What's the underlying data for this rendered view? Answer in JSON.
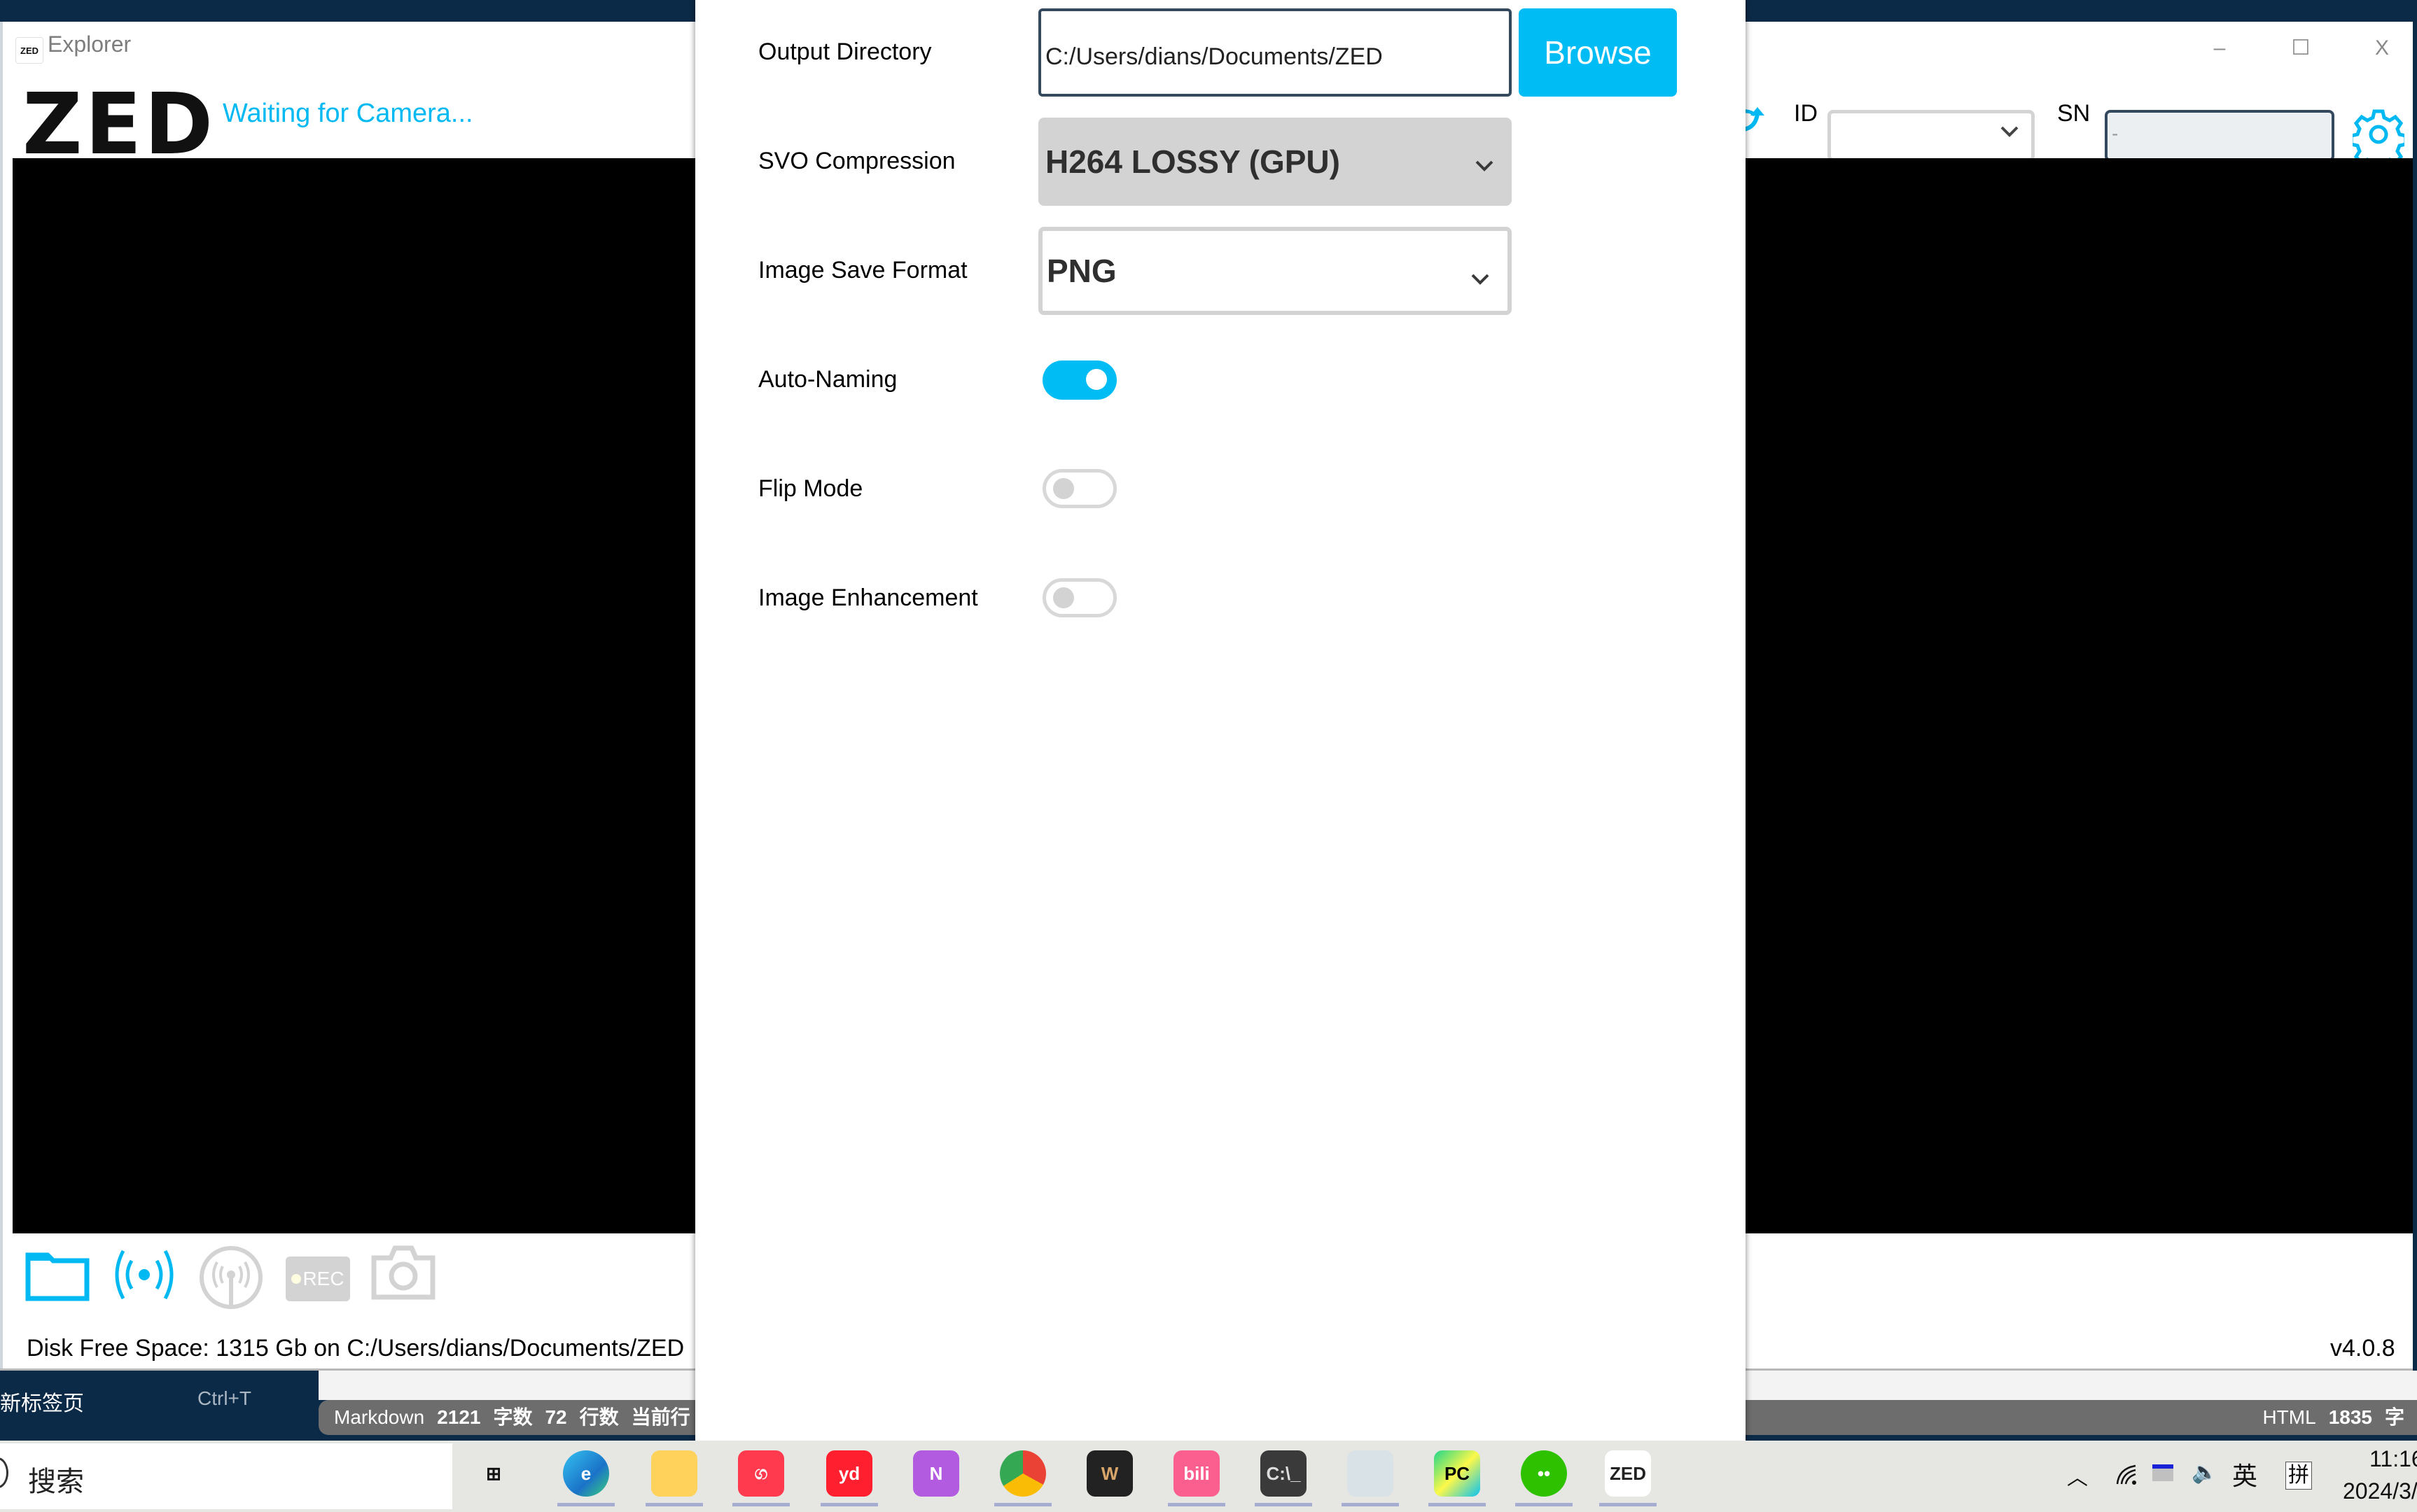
{
  "window": {
    "app_title": "Explorer",
    "app_logo_small": "ZED",
    "logo_text": "ZED",
    "status_text": "Waiting for Camera...",
    "controls": {
      "minimize": "–",
      "maximize": "☐",
      "close": "X"
    }
  },
  "header": {
    "refresh_icon": "refresh-icon",
    "id_label": "ID",
    "id_value": "",
    "sn_label": "SN",
    "sn_value": "-",
    "settings_icon": "gear-icon"
  },
  "toolbar": {
    "icons": [
      "folder-icon",
      "stream-icon",
      "antenna-icon",
      "rec-icon",
      "camera-icon"
    ],
    "rec_label": "REC"
  },
  "footer": {
    "disk_text": "Disk Free Space: 1315 Gb  on C:/Users/dians/Documents/ZED",
    "version": "v4.0.8"
  },
  "settings": {
    "output_directory": {
      "label": "Output Directory",
      "value": "C:/Users/dians/Documents/ZED",
      "browse_label": "Browse"
    },
    "svo_compression": {
      "label": "SVO Compression",
      "selected": "H264 LOSSY (GPU)"
    },
    "image_save_format": {
      "label": "Image Save Format",
      "selected": "PNG"
    },
    "auto_naming": {
      "label": "Auto-Naming",
      "enabled": true
    },
    "flip_mode": {
      "label": "Flip Mode",
      "enabled": false
    },
    "image_enhancement": {
      "label": "Image Enhancement",
      "enabled": false
    }
  },
  "background_app": {
    "tab_label": "新标签页",
    "tab_shortcut": "Ctrl+T",
    "status_left": {
      "mode": "Markdown",
      "chars": "2121",
      "chars_label": "字数",
      "lines": "72",
      "lines_label": "行数",
      "current": "当前行"
    },
    "status_right": {
      "mode": "HTML",
      "chars": "1835",
      "chars_label": "字"
    }
  },
  "taskbar": {
    "search_placeholder": "搜索",
    "apps": [
      {
        "name": "task-view",
        "label": "⊞"
      },
      {
        "name": "edge",
        "label": "e"
      },
      {
        "name": "file-explorer",
        "label": ""
      },
      {
        "name": "netease-music",
        "label": "ග"
      },
      {
        "name": "youdao",
        "label": "yd"
      },
      {
        "name": "onenote",
        "label": "N"
      },
      {
        "name": "chrome",
        "label": ""
      },
      {
        "name": "wps",
        "label": "W"
      },
      {
        "name": "bilibili",
        "label": "bili"
      },
      {
        "name": "terminal",
        "label": "C:\\_"
      },
      {
        "name": "app-window",
        "label": ""
      },
      {
        "name": "pycharm",
        "label": "PC"
      },
      {
        "name": "wechat",
        "label": "••"
      },
      {
        "name": "zed-explorer",
        "label": "ZED"
      }
    ],
    "tray": {
      "chevron": "^",
      "ime_language": "英",
      "ime_mode": "拼",
      "time": "11:16",
      "date": "2024/3/"
    }
  },
  "colors": {
    "accent": "#00bcf5",
    "dark_navy": "#0b2a47",
    "statusbar_gray": "#6d6d6d",
    "select_disabled": "#d3d3d3"
  }
}
